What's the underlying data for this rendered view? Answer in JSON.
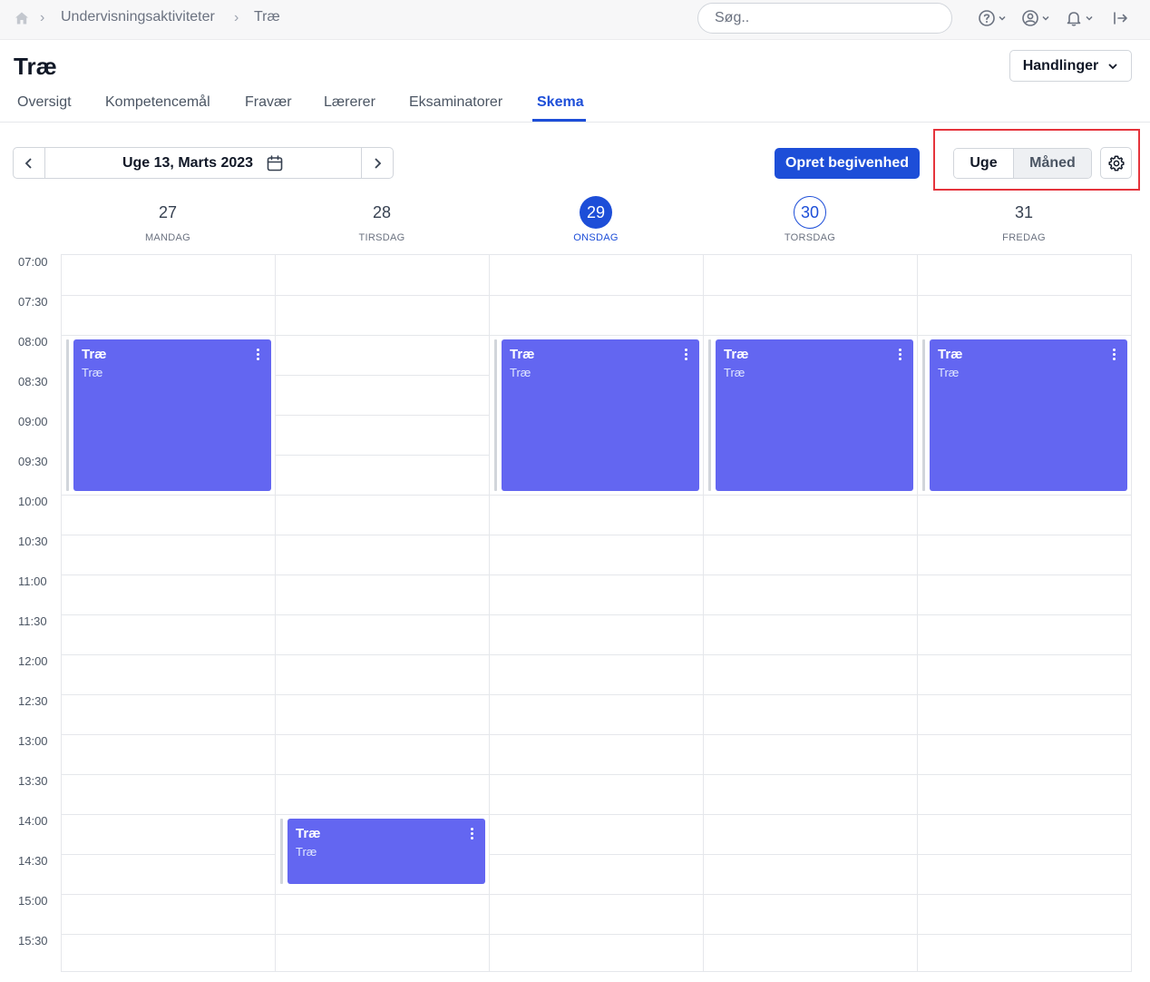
{
  "breadcrumb": {
    "items": [
      "Undervisningsaktiviteter",
      "Træ"
    ]
  },
  "search": {
    "placeholder": "Søg.."
  },
  "page": {
    "title": "Træ",
    "actions_label": "Handlinger"
  },
  "tabs": [
    {
      "label": "Oversigt",
      "active": false
    },
    {
      "label": "Kompetencemål",
      "active": false
    },
    {
      "label": "Fravær",
      "active": false
    },
    {
      "label": "Lærerer",
      "active": false
    },
    {
      "label": "Eksaminatorer",
      "active": false
    },
    {
      "label": "Skema",
      "active": true
    }
  ],
  "toolbar": {
    "date_label": "Uge 13, Marts 2023",
    "create_label": "Opret begivenhed",
    "view_week_label": "Uge",
    "view_month_label": "Måned",
    "selected_view": "Måned"
  },
  "days": [
    {
      "num": "27",
      "name": "MANDAG",
      "state": "normal"
    },
    {
      "num": "28",
      "name": "TIRSDAG",
      "state": "normal"
    },
    {
      "num": "29",
      "name": "ONSDAG",
      "state": "today"
    },
    {
      "num": "30",
      "name": "TORSDAG",
      "state": "outlined"
    },
    {
      "num": "31",
      "name": "FREDAG",
      "state": "normal"
    }
  ],
  "times": [
    "07:00",
    "07:30",
    "08:00",
    "08:30",
    "09:00",
    "09:30",
    "10:00",
    "10:30",
    "11:00",
    "11:30",
    "12:00",
    "12:30",
    "13:00",
    "13:30",
    "14:00",
    "14:30",
    "15:00",
    "15:30"
  ],
  "events": [
    {
      "day": 0,
      "start": "08:00",
      "end": "10:00",
      "title": "Træ",
      "subtitle": "Træ"
    },
    {
      "day": 2,
      "start": "08:00",
      "end": "10:00",
      "title": "Træ",
      "subtitle": "Træ"
    },
    {
      "day": 3,
      "start": "08:00",
      "end": "10:00",
      "title": "Træ",
      "subtitle": "Træ"
    },
    {
      "day": 4,
      "start": "08:00",
      "end": "10:00",
      "title": "Træ",
      "subtitle": "Træ"
    },
    {
      "day": 1,
      "start": "14:00",
      "end": "14:55",
      "title": "Træ",
      "subtitle": "Træ"
    }
  ],
  "colors": {
    "primary": "#1d4ed8",
    "event": "#6366f1",
    "highlight": "#e5343c"
  }
}
